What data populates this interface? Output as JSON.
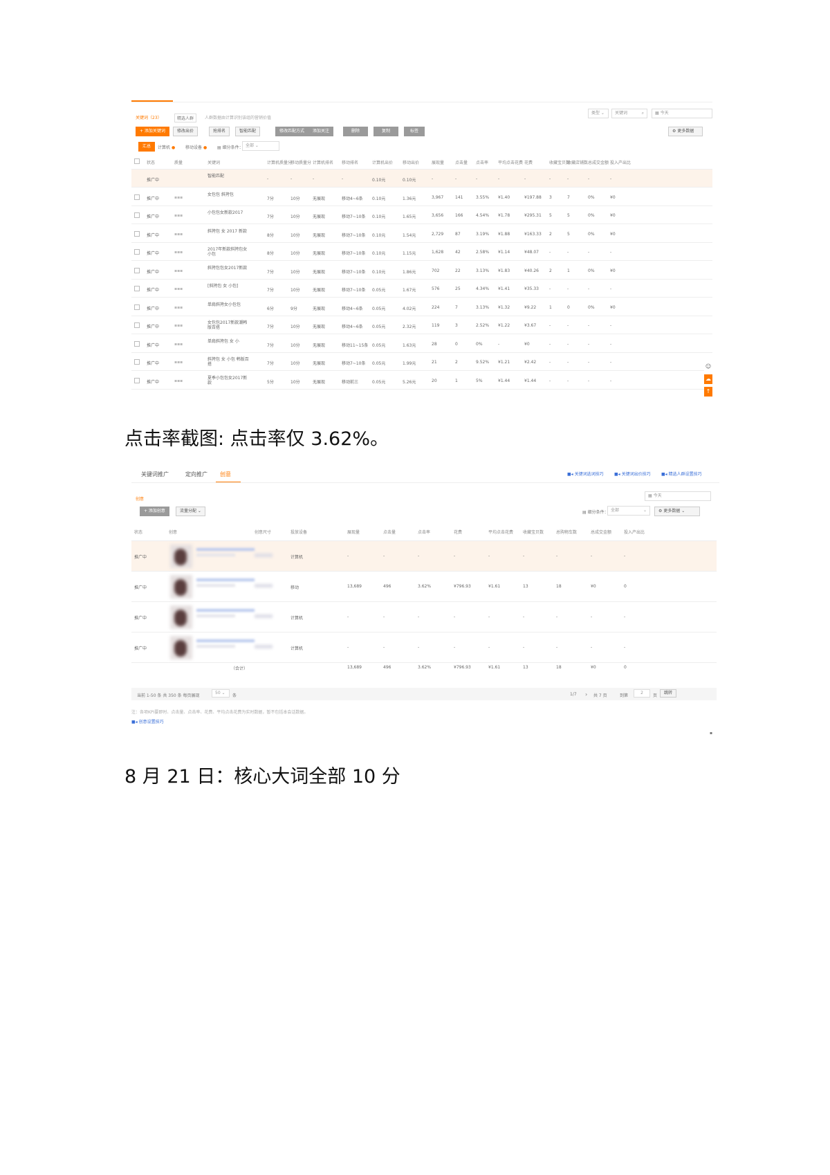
{
  "captions": {
    "first": "点击率截图: 点击率仅 3.62%。",
    "second": "8 月 21 日：核心大词全部 10 分"
  },
  "shot1": {
    "tabs": {
      "keywords": "关键词（23）",
      "crowd": "精选人群",
      "hint": "人群数据由计算识别该组的营销价值"
    },
    "search": {
      "type_label": "类型",
      "keyword_label": "关键词",
      "date_label": "今天"
    },
    "toolbar": {
      "add_keyword": "+ 添加关键词",
      "mod_bid": "修改出价",
      "rank": "抢排名",
      "match": "智能匹配",
      "edit_match": "修改匹配方式",
      "add_focus": "添加关注",
      "delete": "删除",
      "copy": "复制",
      "label": "标签",
      "more": "更多数据"
    },
    "filters": {
      "summary": "汇总",
      "pc": "计算机",
      "mobile": "移动设备",
      "filter_cond": "细分条件：",
      "filter_all": "全部"
    },
    "headers": [
      "状态",
      "质量",
      "关键词",
      "计算机质量分",
      "移动质量分",
      "计算机排名",
      "移动排名",
      "计算机出价",
      "移动出价",
      "展现量",
      "点击量",
      "点击率",
      "平均点击花费",
      "花费",
      "收藏宝贝数",
      "收藏店铺数",
      "总成交金额",
      "投入产出比"
    ],
    "rows": [
      {
        "status": "推广中",
        "keyword": "智能匹配",
        "pcq": "-",
        "mq": "-",
        "pcr": "-",
        "mr": "-",
        "pcb": "0.10元",
        "mb": "0.10元",
        "show": "-",
        "click": "-",
        "ctr": "-",
        "cpc": "-",
        "cost": "-",
        "fav": "-",
        "shop": "-",
        "gmv": "-",
        "roi": "-"
      },
      {
        "status": "推广中",
        "keyword": "女包包 斜挎包",
        "pcq": "7分",
        "mq": "10分",
        "pcr": "无展现",
        "mr": "移动4~6条",
        "pcb": "0.10元",
        "mb": "1.36元",
        "show": "3,967",
        "click": "141",
        "ctr": "3.55%",
        "cpc": "¥1.40",
        "cost": "¥197.88",
        "fav": "3",
        "shop": "7",
        "gmv": "0%",
        "roi": "¥0"
      },
      {
        "status": "推广中",
        "keyword": "小包包女新款2017",
        "pcq": "7分",
        "mq": "10分",
        "pcr": "无展现",
        "mr": "移动7~10条",
        "pcb": "0.10元",
        "mb": "1.65元",
        "show": "3,656",
        "click": "166",
        "ctr": "4.54%",
        "cpc": "¥1.78",
        "cost": "¥295.31",
        "fav": "5",
        "shop": "5",
        "gmv": "0%",
        "roi": "¥0"
      },
      {
        "status": "推广中",
        "keyword": "斜挎包 女 2017 新款",
        "pcq": "8分",
        "mq": "10分",
        "pcr": "无展现",
        "mr": "移动7~10条",
        "pcb": "0.10元",
        "mb": "1.54元",
        "show": "2,729",
        "click": "87",
        "ctr": "3.19%",
        "cpc": "¥1.88",
        "cost": "¥163.33",
        "fav": "2",
        "shop": "5",
        "gmv": "0%",
        "roi": "¥0"
      },
      {
        "status": "推广中",
        "keyword": "2017年新款斜挎包女小包",
        "pcq": "8分",
        "mq": "10分",
        "pcr": "无展现",
        "mr": "移动7~10条",
        "pcb": "0.10元",
        "mb": "1.15元",
        "show": "1,628",
        "click": "42",
        "ctr": "2.58%",
        "cpc": "¥1.14",
        "cost": "¥48.07",
        "fav": "-",
        "shop": "-",
        "gmv": "-",
        "roi": "-"
      },
      {
        "status": "推广中",
        "keyword": "斜挎包包女2017新款",
        "pcq": "7分",
        "mq": "10分",
        "pcr": "无展现",
        "mr": "移动7~10条",
        "pcb": "0.10元",
        "mb": "1.86元",
        "show": "702",
        "click": "22",
        "ctr": "3.13%",
        "cpc": "¥1.83",
        "cost": "¥40.26",
        "fav": "2",
        "shop": "1",
        "gmv": "0%",
        "roi": "¥0"
      },
      {
        "status": "推广中",
        "keyword": "[斜挎包 女 小包]",
        "pcq": "7分",
        "mq": "10分",
        "pcr": "无展现",
        "mr": "移动7~10条",
        "pcb": "0.05元",
        "mb": "1.67元",
        "show": "576",
        "click": "25",
        "ctr": "4.34%",
        "cpc": "¥1.41",
        "cost": "¥35.33",
        "fav": "-",
        "shop": "-",
        "gmv": "-",
        "roi": "-"
      },
      {
        "status": "推广中",
        "keyword": "单肩斜挎女小包包",
        "pcq": "6分",
        "mq": "9分",
        "pcr": "无展现",
        "mr": "移动4~6条",
        "pcb": "0.05元",
        "mb": "4.02元",
        "show": "224",
        "click": "7",
        "ctr": "3.13%",
        "cpc": "¥1.32",
        "cost": "¥9.22",
        "fav": "1",
        "shop": "0",
        "gmv": "0%",
        "roi": "¥0"
      },
      {
        "status": "推广中",
        "keyword": "女包包2017新款潮韩版百搭",
        "pcq": "7分",
        "mq": "10分",
        "pcr": "无展现",
        "mr": "移动4~6条",
        "pcb": "0.05元",
        "mb": "2.32元",
        "show": "119",
        "click": "3",
        "ctr": "2.52%",
        "cpc": "¥1.22",
        "cost": "¥3.67",
        "fav": "-",
        "shop": "-",
        "gmv": "-",
        "roi": "-"
      },
      {
        "status": "推广中",
        "keyword": "单肩斜挎包 女 小",
        "pcq": "7分",
        "mq": "10分",
        "pcr": "无展现",
        "mr": "移动11~15条",
        "pcb": "0.05元",
        "mb": "1.63元",
        "show": "28",
        "click": "0",
        "ctr": "0%",
        "cpc": "-",
        "cost": "¥0",
        "fav": "-",
        "shop": "-",
        "gmv": "-",
        "roi": "-"
      },
      {
        "status": "推广中",
        "keyword": "斜挎包 女 小包 韩版百搭",
        "pcq": "7分",
        "mq": "10分",
        "pcr": "无展现",
        "mr": "移动7~10条",
        "pcb": "0.05元",
        "mb": "1.99元",
        "show": "21",
        "click": "2",
        "ctr": "9.52%",
        "cpc": "¥1.21",
        "cost": "¥2.42",
        "fav": "-",
        "shop": "-",
        "gmv": "-",
        "roi": "-"
      },
      {
        "status": "推广中",
        "keyword": "夏季小包包女2017新款",
        "pcq": "5分",
        "mq": "10分",
        "pcr": "无展现",
        "mr": "移动前三",
        "pcb": "0.05元",
        "mb": "5.26元",
        "show": "20",
        "click": "1",
        "ctr": "5%",
        "cpc": "¥1.44",
        "cost": "¥1.44",
        "fav": "-",
        "shop": "-",
        "gmv": "-",
        "roi": "-"
      }
    ]
  },
  "shot2": {
    "tabs": {
      "keyword": "关键词推广",
      "target": "定向推广",
      "creative": "创意"
    },
    "links": {
      "video1": "关键词选词技巧",
      "video2": "关键词出价技巧",
      "video3": "精选人群设置技巧"
    },
    "section_title": "创意",
    "date_label": "今天",
    "toolbar": {
      "add_creative": "+ 添加创意",
      "split": "流量分配",
      "filter_cond": "细分条件：",
      "filter_all": "全部",
      "more": "更多数据"
    },
    "headers": [
      "状态",
      "创意",
      "创意尺寸",
      "投放设备",
      "展现量",
      "点击量",
      "点击率",
      "花费",
      "平均点击花费",
      "收藏宝贝数",
      "总购物车数",
      "总成交金额",
      "投入产出比"
    ],
    "rows": [
      {
        "status": "推广中",
        "device": "计算机",
        "show": "-",
        "click": "-",
        "ctr": "-",
        "cost": "-",
        "cpc": "-",
        "fav": "-",
        "cart": "-",
        "gmv": "-",
        "roi": "-"
      },
      {
        "status": "推广中",
        "device": "移动",
        "show": "13,689",
        "click": "496",
        "ctr": "3.62%",
        "cost": "¥796.93",
        "cpc": "¥1.61",
        "fav": "13",
        "cart": "18",
        "gmv": "¥0",
        "roi": "0"
      },
      {
        "status": "推广中",
        "device": "计算机",
        "show": "-",
        "click": "-",
        "ctr": "-",
        "cost": "-",
        "cpc": "-",
        "fav": "-",
        "cart": "-",
        "gmv": "-",
        "roi": "-"
      },
      {
        "status": "推广中",
        "device": "计算机",
        "show": "-",
        "click": "-",
        "ctr": "-",
        "cost": "-",
        "cpc": "-",
        "fav": "-",
        "cart": "-",
        "gmv": "-",
        "roi": "-"
      }
    ],
    "total": {
      "label": "（合计）",
      "show": "13,689",
      "click": "496",
      "ctr": "3.62%",
      "cost": "¥796.93",
      "cpc": "¥1.61",
      "fav": "13",
      "cart": "18",
      "gmv": "¥0",
      "roi": "0"
    },
    "pager": {
      "info": "当前 1-50 条  共 350 条  每页展现",
      "per": "50",
      "unit": "条",
      "page": "1/7",
      "total_pages": "共 7 页",
      "goto": "到第",
      "page_input": "2",
      "page_unit": "页",
      "confirm": "跳转"
    },
    "note": "注：各项KPI要即时、点击量、点击率、花费、平均点击花费为实时数据，暂不包括本会话数据。",
    "help_link": "创意设置技巧"
  }
}
